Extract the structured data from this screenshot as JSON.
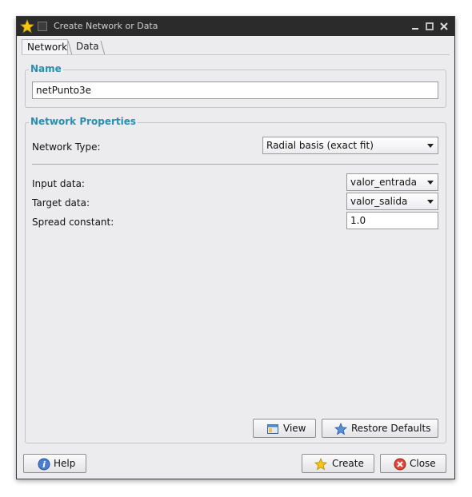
{
  "window": {
    "title": "Create Network or Data"
  },
  "tabs": [
    {
      "label": "Network"
    },
    {
      "label": "Data"
    }
  ],
  "name_group": {
    "legend": "Name",
    "value": "netPunto3e"
  },
  "props_group": {
    "legend": "Network Properties",
    "network_type_label": "Network Type:",
    "network_type_value": "Radial basis (exact fit)",
    "input_label": "Input data:",
    "input_value": "valor_entrada",
    "target_label": "Target data:",
    "target_value": "valor_salida",
    "spread_label": "Spread constant:",
    "spread_value": "1.0"
  },
  "buttons": {
    "view": "View",
    "restore": "Restore Defaults",
    "help": "Help",
    "create": "Create",
    "close": "Close"
  },
  "colors": {
    "accent": "#2a8db0",
    "titlebar": "#2b2b2b"
  }
}
